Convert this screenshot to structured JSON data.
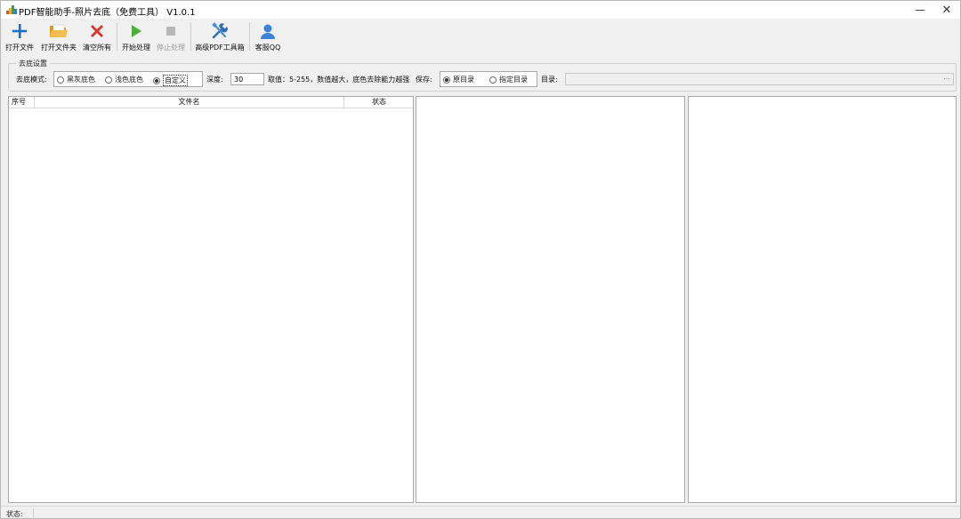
{
  "window": {
    "title": "PDF智能助手-照片去底（免费工具） V1.0.1",
    "minimize_glyph": "—",
    "close_glyph": "✕"
  },
  "toolbar": {
    "open_file": "打开文件",
    "open_folder": "打开文件夹",
    "clear_all": "清空所有",
    "start": "开始处理",
    "stop": "停止处理",
    "advanced": "高级PDF工具箱",
    "support": "客服QQ"
  },
  "settings": {
    "group_title": "去底设置",
    "mode_label": "去底模式:",
    "mode_options": [
      "黑灰底色",
      "浅色底色",
      "自定义"
    ],
    "mode_selected": "自定义",
    "depth_label": "深度:",
    "depth_value": "30",
    "range_hint": "取值：5-255，数值越大，底色去除能力越强",
    "save_label": "保存:",
    "save_options": [
      "原目录",
      "指定目录"
    ],
    "save_selected": "原目录",
    "dir_label": "目录:",
    "dir_value": "",
    "browse_glyph": "..."
  },
  "file_list": {
    "columns": [
      "序号",
      "文件名",
      "状态"
    ],
    "rows": []
  },
  "status": {
    "label": "状态:",
    "text": ""
  },
  "colors": {
    "accent_blue": "#2f7fd6",
    "open_file_plus": "#1f6fd0",
    "folder_orange": "#e9a93a",
    "clear_red": "#d9372b",
    "play_green": "#4caf3c",
    "stop_gray": "#b8b8b8",
    "support_blue": "#3b82d9"
  }
}
